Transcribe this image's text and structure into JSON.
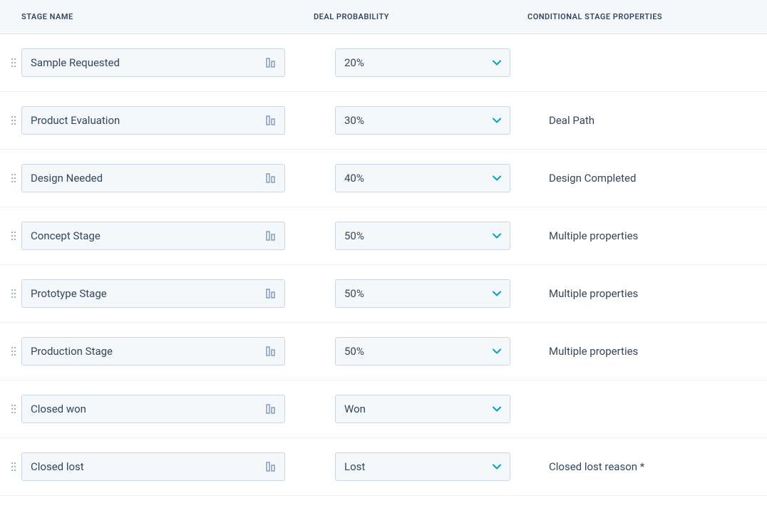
{
  "headers": {
    "stage_name": "STAGE NAME",
    "deal_probability": "DEAL PROBABILITY",
    "conditional_stage_properties": "CONDITIONAL STAGE PROPERTIES"
  },
  "stages": [
    {
      "name": "Sample Requested",
      "probability": "20%",
      "conditional": ""
    },
    {
      "name": "Product Evaluation",
      "probability": "30%",
      "conditional": "Deal Path"
    },
    {
      "name": "Design Needed",
      "probability": "40%",
      "conditional": "Design Completed"
    },
    {
      "name": "Concept Stage",
      "probability": "50%",
      "conditional": "Multiple properties"
    },
    {
      "name": "Prototype Stage",
      "probability": "50%",
      "conditional": "Multiple properties"
    },
    {
      "name": "Production Stage",
      "probability": "50%",
      "conditional": "Multiple properties"
    },
    {
      "name": "Closed won",
      "probability": "Won",
      "conditional": ""
    },
    {
      "name": "Closed lost",
      "probability": "Lost",
      "conditional": "Closed lost reason *"
    }
  ],
  "colors": {
    "accent": "#00a4bd",
    "text": "#33475b",
    "border": "#cbd6e2",
    "input_bg": "#f5f8fa"
  }
}
